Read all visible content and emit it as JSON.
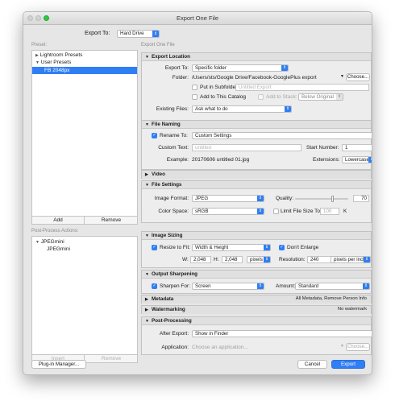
{
  "window": {
    "title": "Export One File"
  },
  "export_to": {
    "label": "Export To:",
    "value": "Hard Drive"
  },
  "left": {
    "preset_header": "Preset:",
    "presets": [
      "Lightroom Presets",
      "User Presets",
      "FB 2048px"
    ],
    "add": "Add",
    "remove": "Remove",
    "post_header": "Post-Process Actions:",
    "actions": [
      "JPEGmini",
      "JPEGmini"
    ],
    "insert": "Insert",
    "remove2": "Remove"
  },
  "right_header": "Export One File",
  "location": {
    "title": "Export Location",
    "export_to_label": "Export To:",
    "export_to_value": "Specific folder",
    "folder_label": "Folder:",
    "folder_path": "/Users/sts/Google Drive/Facebook-GooglePlus export",
    "choose": "Choose...",
    "subfolder_label": "Put in Subfolder:",
    "subfolder_placeholder": "Untitled Export",
    "add_catalog": "Add to This Catalog",
    "add_stack": "Add to Stack:",
    "below_original": "Below Original",
    "existing_label": "Existing Files:",
    "existing_value": "Ask what to do"
  },
  "naming": {
    "title": "File Naming",
    "rename_label": "Rename To:",
    "rename_value": "Custom Settings",
    "custom_label": "Custom Text:",
    "custom_placeholder": "untitled",
    "start_label": "Start Number:",
    "start_value": "1",
    "example_label": "Example:",
    "example_value": "20170606 untitled 01.jpg",
    "ext_label": "Extensions:",
    "ext_value": "Lowercase"
  },
  "video": {
    "title": "Video"
  },
  "settings": {
    "title": "File Settings",
    "format_label": "Image Format:",
    "format_value": "JPEG",
    "quality_label": "Quality:",
    "quality_value": "70",
    "quality_fraction": 0.7,
    "color_label": "Color Space:",
    "color_value": "sRGB",
    "limit_label": "Limit File Size To:",
    "limit_value": "100",
    "limit_unit": "K"
  },
  "sizing": {
    "title": "Image Sizing",
    "resize_label": "Resize to Fit:",
    "resize_value": "Width & Height",
    "dont_enlarge": "Don't Enlarge",
    "w_label": "W:",
    "w_value": "2,048",
    "h_label": "H:",
    "h_value": "2,048",
    "unit": "pixels",
    "res_label": "Resolution:",
    "res_value": "240",
    "res_unit": "pixels per inch"
  },
  "sharpening": {
    "title": "Output Sharpening",
    "sharpen_label": "Sharpen For:",
    "sharpen_value": "Screen",
    "amount_label": "Amount:",
    "amount_value": "Standard"
  },
  "metadata": {
    "title": "Metadata",
    "summary": "All Metadata, Remove Person Info"
  },
  "watermarking": {
    "title": "Watermarking",
    "summary": "No watermark"
  },
  "post": {
    "title": "Post-Processing",
    "after_label": "After Export:",
    "after_value": "Show in Finder",
    "app_label": "Application:",
    "app_placeholder": "Choose an application...",
    "choose": "Choose..."
  },
  "footer": {
    "plugin": "Plug-in Manager...",
    "cancel": "Cancel",
    "export": "Export"
  }
}
